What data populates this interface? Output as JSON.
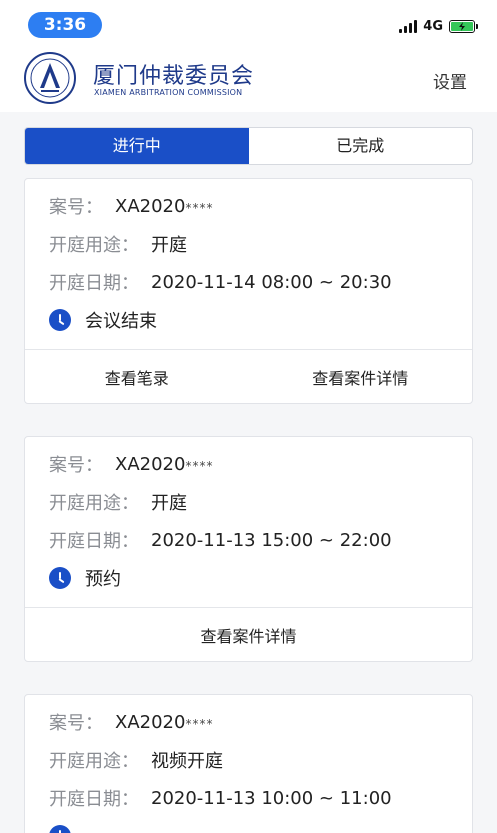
{
  "status_bar": {
    "time": "3:36",
    "network": "4G"
  },
  "header": {
    "org_name": "厦门仲裁委员会",
    "org_name_en": "XIAMEN ARBITRATION COMMISSION",
    "settings_label": "设置"
  },
  "tabs": [
    {
      "label": "进行中",
      "active": true
    },
    {
      "label": "已完成",
      "active": false
    }
  ],
  "labels": {
    "case_no": "案号：",
    "purpose": "开庭用途：",
    "date": "开庭日期："
  },
  "cases": [
    {
      "case_no": "XA2020",
      "case_no_mask": "****",
      "purpose": "开庭",
      "date": "2020-11-14 08:00 ~ 20:30",
      "status": "会议结束",
      "actions": [
        "查看笔录",
        "查看案件详情"
      ]
    },
    {
      "case_no": "XA2020",
      "case_no_mask": "****",
      "purpose": "开庭",
      "date": "2020-11-13 15:00 ~ 22:00",
      "status": "预约",
      "actions": [
        "查看案件详情"
      ]
    },
    {
      "case_no": "XA2020",
      "case_no_mask": "****",
      "purpose": "视频开庭",
      "date": "2020-11-13 10:00 ~ 11:00"
    }
  ],
  "colors": {
    "primary": "#1a4fc7",
    "time_pill": "#2d7ef2",
    "battery": "#34c759"
  }
}
